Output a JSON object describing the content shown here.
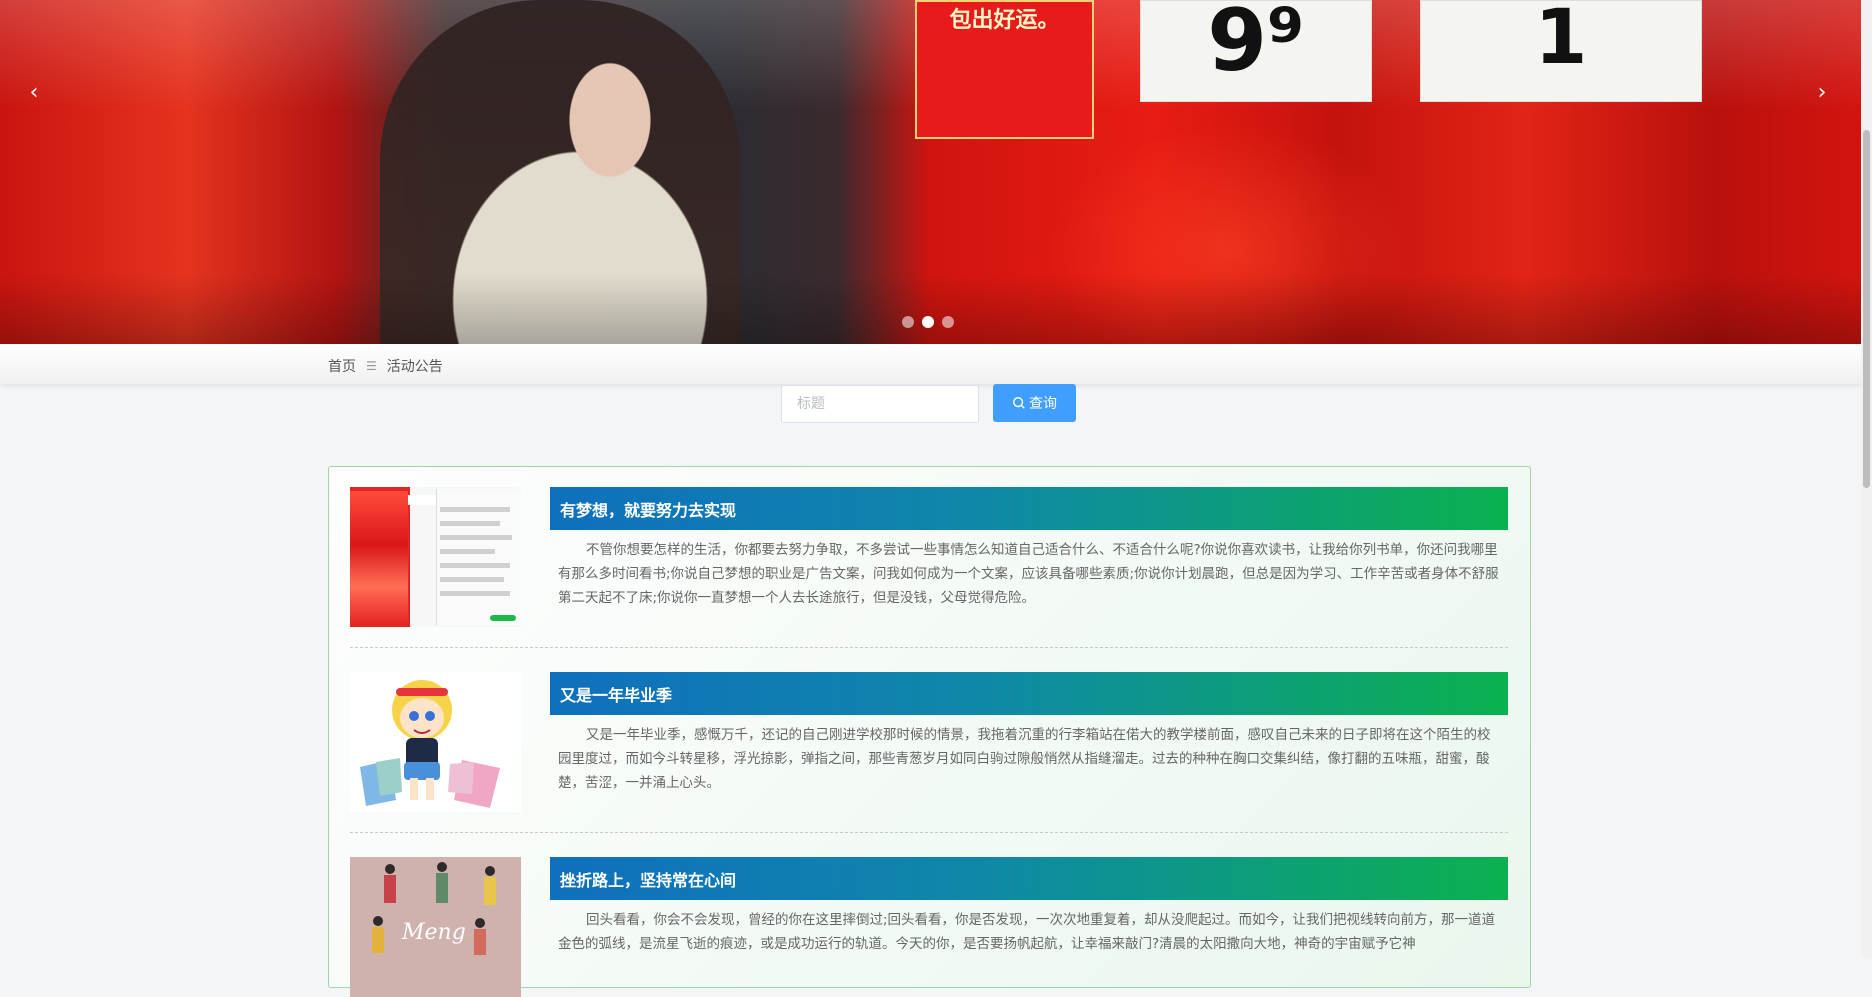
{
  "banner": {
    "prev_arrow": "‹",
    "next_arrow": "›",
    "slides": 3,
    "active_slide": 2,
    "sign_1": "9⁹",
    "sign_2": "1",
    "poster_text": "包出好运。"
  },
  "breadcrumb": {
    "home": "首页",
    "separator": "☰",
    "current": "活动公告"
  },
  "search": {
    "placeholder": "标题",
    "button_label": "查询"
  },
  "articles": [
    {
      "title": "有梦想，就要努力去实现",
      "summary": "不管你想要怎样的生活，你都要去努力争取，不多尝试一些事情怎么知道自己适合什么、不适合什么呢?你说你喜欢读书，让我给你列书单，你还问我哪里有那么多时间看书;你说自己梦想的职业是广告文案，问我如何成为一个文案，应该具备哪些素质;你说你计划晨跑，但总是因为学习、工作辛苦或者身体不舒服第二天起不了床;你说你一直梦想一个人去长途旅行，但是没钱，父母觉得危险。"
    },
    {
      "title": "又是一年毕业季",
      "summary": "又是一年毕业季，感慨万千，还记的自己刚进学校那时候的情景，我拖着沉重的行李箱站在偌大的教学楼前面，感叹自己未来的日子即将在这个陌生的校园里度过，而如今斗转星移，浮光掠影，弹指之间，那些青葱岁月如同白驹过隙般悄然从指缝溜走。过去的种种在胸口交集纠结，像打翻的五味瓶，甜蜜，酸楚，苦涩，一并涌上心头。"
    },
    {
      "title": "挫折路上，坚持常在心间",
      "summary": "回头看看，你会不会发现，曾经的你在这里摔倒过;回头看看，你是否发现，一次次地重复着，却从没爬起过。而如今，让我们把视线转向前方，那一道道金色的弧线，是流星飞逝的痕迹，或是成功运行的轨道。今天的你，是否要扬帆起航，让幸福来敲门?清晨的太阳撒向大地，神奇的宇宙赋予它神"
    }
  ],
  "thumb_3_text": "Meng",
  "colors": {
    "primary_button": "#409eff",
    "title_gradient_start": "#0f6fbd",
    "title_gradient_end": "#0bb14f",
    "panel_border": "#9fd6a8"
  }
}
